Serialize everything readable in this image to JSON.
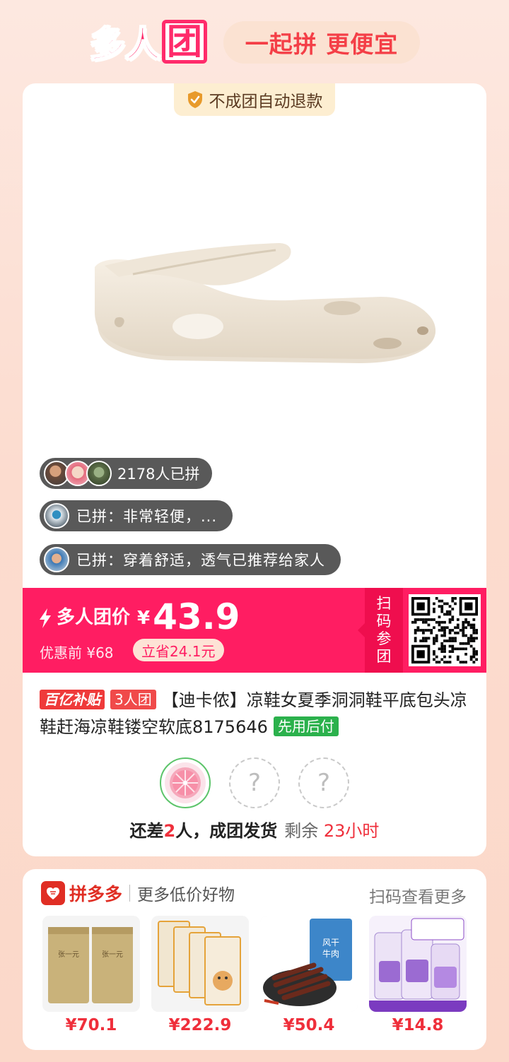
{
  "header": {
    "logo_text_main": "多人",
    "logo_text_last": "团",
    "slogan": "一起拼 更便宜"
  },
  "guarantee": "不成团自动退款",
  "buyers": {
    "count_text": "2178人已拼"
  },
  "reviews": [
    {
      "text": "已拼：非常轻便，..."
    },
    {
      "text": "已拼：穿着舒适，透气已推荐给家人"
    }
  ],
  "price": {
    "label": "多人团价",
    "currency": "¥",
    "amount": "43.9",
    "original": "优惠前 ¥68",
    "save": "立省24.1元",
    "scan_label": [
      "扫",
      "码",
      "参",
      "团"
    ]
  },
  "product": {
    "tag_subsidy": "百亿补贴",
    "tag_group": "3人团",
    "title": "【迪卡侬】凉鞋女夏季洞洞鞋平底包头凉鞋赶海凉鞋镂空软底8175646",
    "tag_pay_later": "先用后付"
  },
  "group": {
    "slots_empty_symbol": "?",
    "status_prefix": "还差",
    "status_count": "2",
    "status_suffix": "人，成团发货",
    "remaining_label": "剩余",
    "remaining_value": "23小时"
  },
  "recommend": {
    "brand": "拼多多",
    "subtitle": "更多低价好物",
    "more": "扫码查看更多",
    "items": [
      {
        "price": "¥70.1"
      },
      {
        "price": "¥222.9"
      },
      {
        "price": "¥50.4"
      },
      {
        "price": "¥14.8"
      }
    ]
  },
  "colors": {
    "accent": "#ff1d62",
    "brand_red": "#e02e24",
    "group_green": "#5cc46a"
  }
}
